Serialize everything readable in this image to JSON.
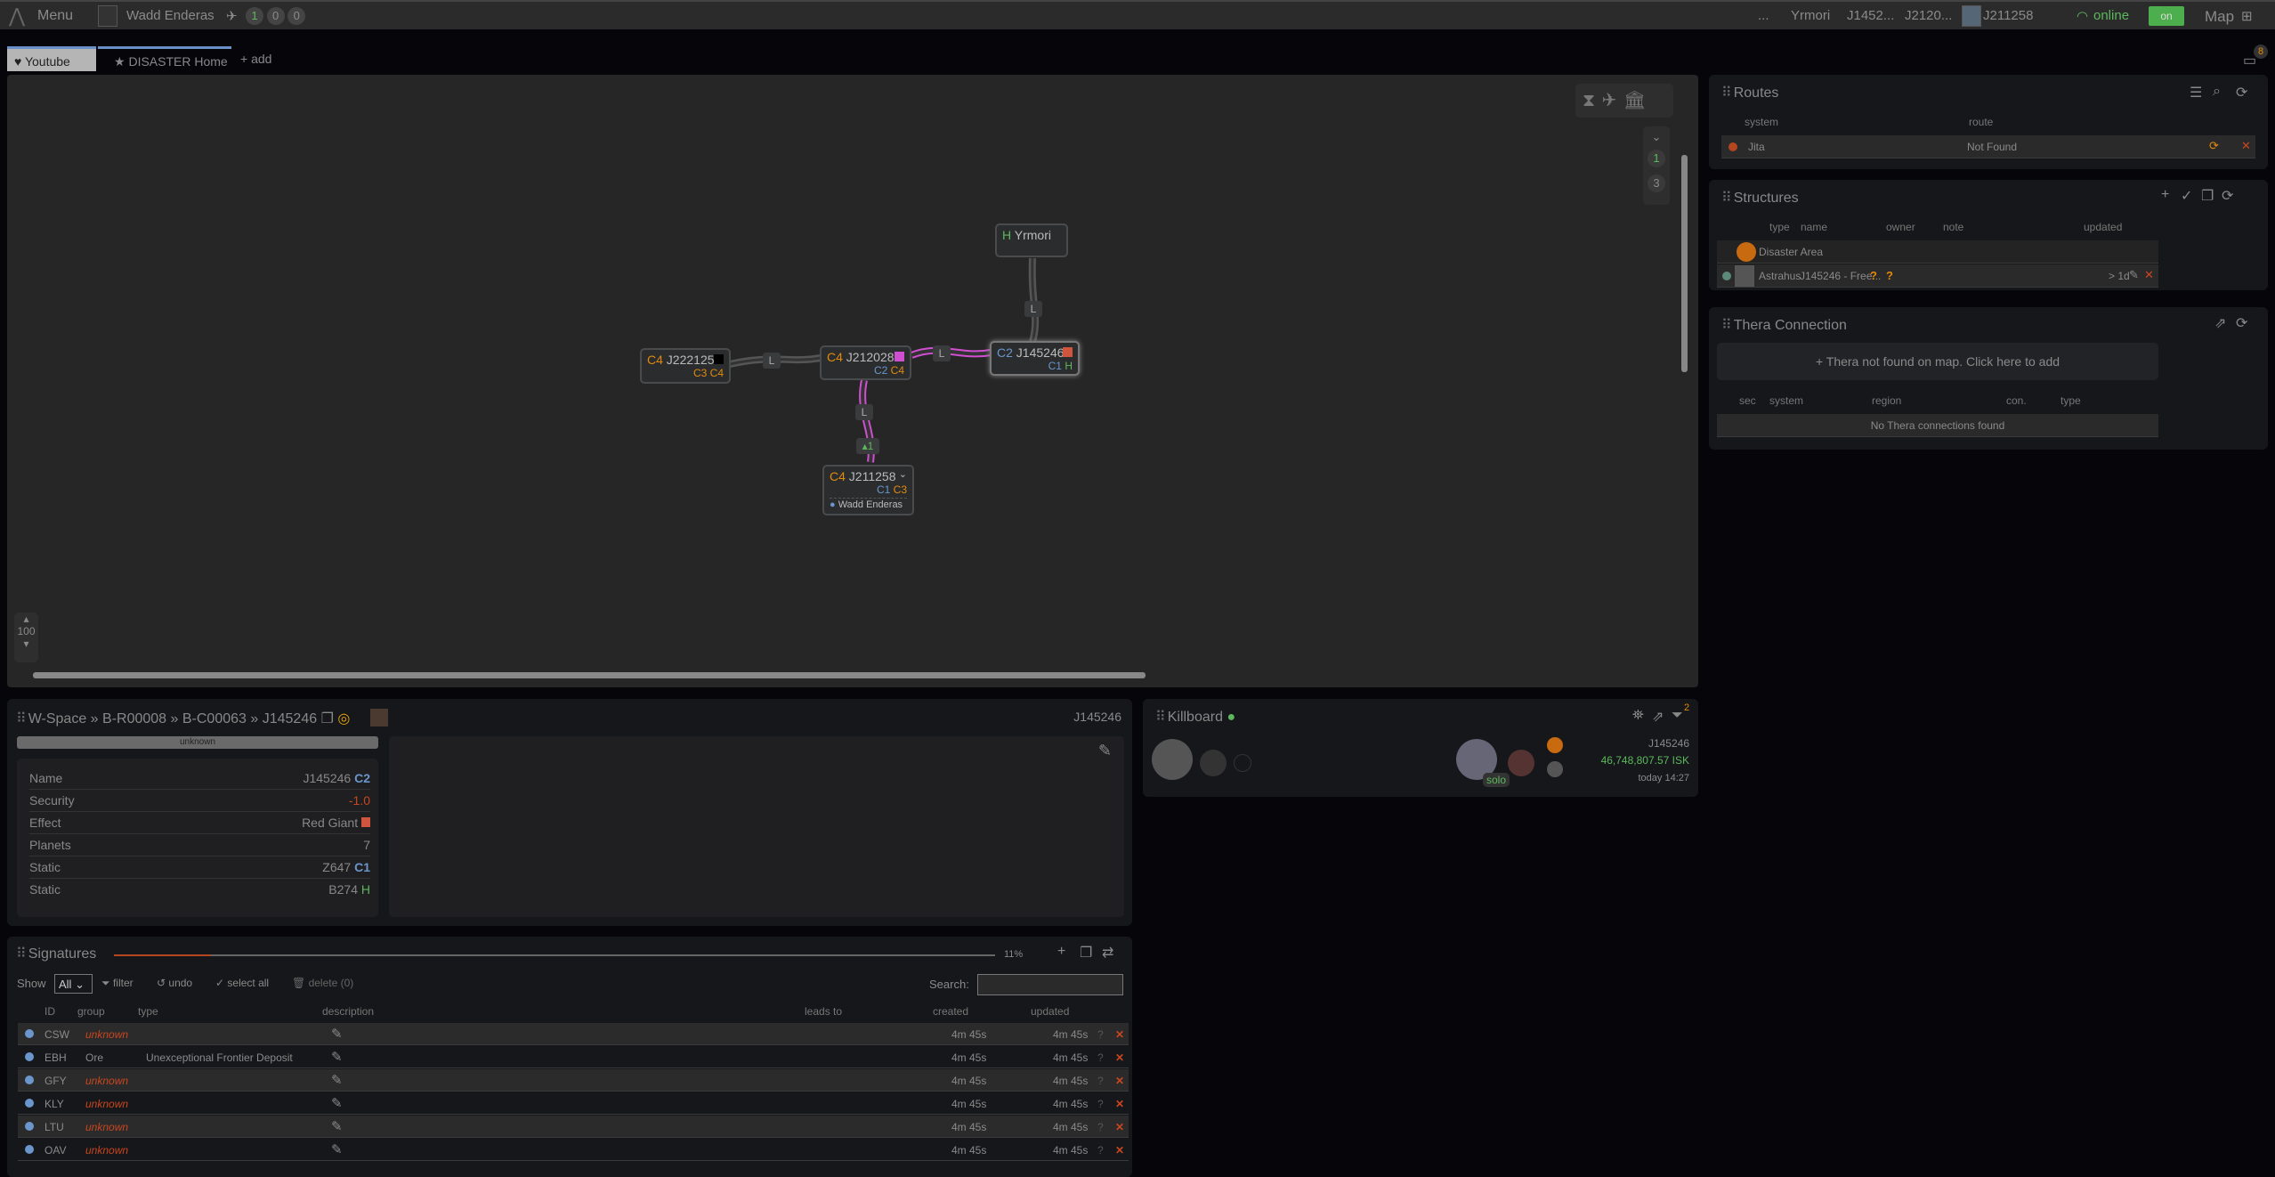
{
  "topbar": {
    "menu": "Menu",
    "character": "Wadd Enderas",
    "counts": [
      "1",
      "0",
      "0"
    ],
    "breadcrumbs": [
      "...",
      "Yrmori",
      "J1452...",
      "J2120...",
      "J211258"
    ],
    "status": "online",
    "toggle": "on",
    "map_label": "Map"
  },
  "tabs": [
    {
      "label": "Youtube",
      "icon": "heart-icon"
    },
    {
      "label": "DISASTER Home",
      "icon": "star-icon"
    },
    {
      "label": "add",
      "icon": "plus-icon"
    }
  ],
  "notifications": "8",
  "map": {
    "zoom": "100",
    "layer_counts": [
      "1",
      "3"
    ],
    "nodes": [
      {
        "id": "yrmori",
        "class": "H",
        "name": "Yrmori",
        "statics": []
      },
      {
        "id": "j145246",
        "class": "C2",
        "name": "J145246",
        "effect_color": "#d0553f",
        "statics": [
          "C1",
          "H"
        ]
      },
      {
        "id": "j212028",
        "class": "C4",
        "name": "J212028",
        "effect_color": "#d04fd0",
        "statics": [
          "C2",
          "C4"
        ]
      },
      {
        "id": "j222125",
        "class": "C4",
        "name": "J222125",
        "effect_color": "#000000",
        "statics": [
          "C3",
          "C4"
        ]
      },
      {
        "id": "j211258",
        "class": "C4",
        "name": "J211258",
        "statics": [
          "C1",
          "C3"
        ],
        "pilot": "Wadd Enderas"
      }
    ],
    "connection_label": "L",
    "pilot_count": "1"
  },
  "routes": {
    "title": "Routes",
    "headers": [
      "system",
      "route"
    ],
    "rows": [
      {
        "system": "Jita",
        "route": "Not Found"
      }
    ]
  },
  "structures": {
    "title": "Structures",
    "headers": [
      "type",
      "name",
      "owner",
      "note",
      "updated"
    ],
    "rows": [
      {
        "type": "",
        "name": "Disaster Area",
        "owner": "",
        "note": "",
        "updated": ""
      },
      {
        "type": "Astrahus",
        "name": "J145246 - Free...",
        "owner": "?",
        "note": "?",
        "updated": "> 1d"
      }
    ]
  },
  "thera": {
    "title": "Thera Connection",
    "add": "Thera not found on map. Click here to add",
    "headers": [
      "sec",
      "system",
      "region",
      "con.",
      "type"
    ],
    "empty": "No Thera connections found"
  },
  "system": {
    "breadcrumb": [
      "W-Space",
      "B-R00008",
      "B-C00063",
      "J145246"
    ],
    "name_right": "J145246",
    "status": "unknown",
    "info": [
      {
        "k": "Name",
        "v": "J145246",
        "tag": "C2"
      },
      {
        "k": "Security",
        "v": "-1.0"
      },
      {
        "k": "Effect",
        "v": "Red Giant"
      },
      {
        "k": "Planets",
        "v": "7"
      },
      {
        "k": "Static",
        "v": "Z647",
        "tag": "C1"
      },
      {
        "k": "Static",
        "v": "B274",
        "tag": "H"
      }
    ]
  },
  "killboard": {
    "title": "Killboard",
    "filter_count": "2",
    "system": "J145246",
    "value": "46,748,807.57 ISK",
    "time": "today 14:27",
    "solo": "solo"
  },
  "signatures": {
    "title": "Signatures",
    "progress": "11%",
    "progress_value": 11,
    "show_label": "Show",
    "show_value": "All",
    "filter": "filter",
    "undo": "undo",
    "select_all": "select all",
    "delete": "delete (0)",
    "search_label": "Search:",
    "search_value": "",
    "headers": [
      "ID",
      "group",
      "type",
      "description",
      "leads to",
      "created",
      "updated"
    ],
    "rows": [
      {
        "id": "CSW",
        "group": "unknown",
        "type": "",
        "created": "4m  45s",
        "updated": "4m  45s"
      },
      {
        "id": "EBH",
        "group": "Ore",
        "type": "Unexceptional Frontier Deposit",
        "created": "4m  45s",
        "updated": "4m  45s"
      },
      {
        "id": "GFY",
        "group": "unknown",
        "type": "",
        "created": "4m  45s",
        "updated": "4m  45s"
      },
      {
        "id": "KLY",
        "group": "unknown",
        "type": "",
        "created": "4m  45s",
        "updated": "4m  45s"
      },
      {
        "id": "LTU",
        "group": "unknown",
        "type": "",
        "created": "4m  45s",
        "updated": "4m  45s"
      },
      {
        "id": "OAV",
        "group": "unknown",
        "type": "",
        "created": "4m  45s",
        "updated": "4m  45s"
      }
    ]
  }
}
